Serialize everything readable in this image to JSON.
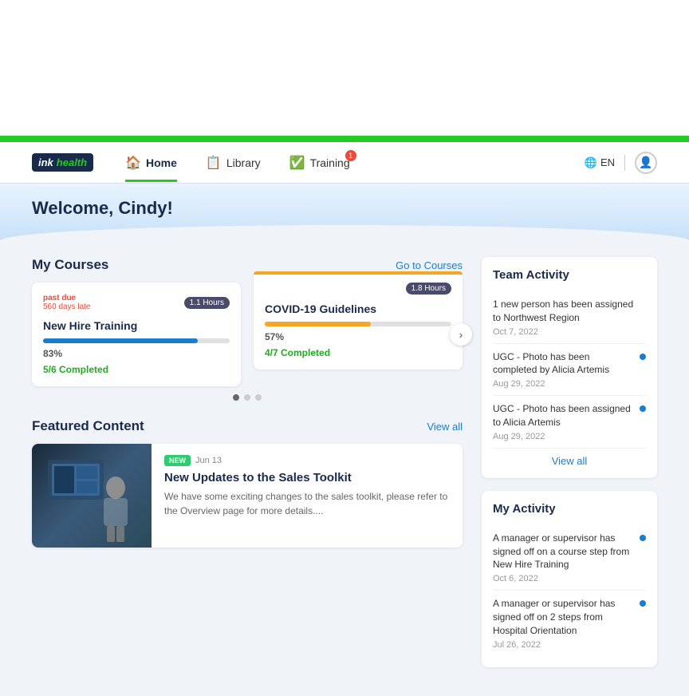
{
  "top_whitespace_height": 170,
  "green_bar": {
    "color": "#22cc22"
  },
  "navbar": {
    "logo": {
      "ink": "ink",
      "health": "health"
    },
    "nav_items": [
      {
        "label": "Home",
        "icon": "🏠",
        "active": true,
        "badge": null
      },
      {
        "label": "Library",
        "icon": "📋",
        "active": false,
        "badge": null
      },
      {
        "label": "Training",
        "icon": "✅",
        "active": false,
        "badge": "1"
      }
    ],
    "lang": "EN",
    "user_icon": "👤"
  },
  "welcome": {
    "text": "Welcome, Cindy!"
  },
  "my_courses": {
    "title": "My Courses",
    "link_label": "Go to Courses",
    "courses": [
      {
        "past_due": true,
        "past_due_label": "past due",
        "late_label": "560 days late",
        "hours": "1.1 Hours",
        "title": "New Hire Training",
        "progress_pct": 83,
        "progress_label": "83%",
        "completed": "5/6 Completed",
        "bar_color": "#1a7ccc"
      },
      {
        "past_due": false,
        "hours": "1.8 Hours",
        "title": "COVID-19 Guidelines",
        "progress_pct": 57,
        "progress_label": "57%",
        "completed": "4/7 Completed",
        "bar_color": "#f5a623",
        "has_orange_top": true
      }
    ],
    "carousel_dots": [
      true,
      false,
      false
    ]
  },
  "featured_content": {
    "title": "Featured Content",
    "link_label": "View all",
    "item": {
      "badge": "NEW",
      "date": "Jun 13",
      "title": "New Updates to the Sales Toolkit",
      "description": "We have some exciting changes to the sales toolkit, please refer to the Overview page for more details...."
    }
  },
  "team_activity": {
    "title": "Team Activity",
    "items": [
      {
        "text": "1 new person has been assigned to Northwest Region",
        "date": "Oct 7, 2022",
        "has_dot": false
      },
      {
        "text": "UGC - Photo has been completed by Alicia Artemis",
        "date": "Aug 29, 2022",
        "has_dot": true
      },
      {
        "text": "UGC - Photo has been assigned to Alicia Artemis",
        "date": "Aug 29, 2022",
        "has_dot": true
      }
    ],
    "view_all_label": "View all"
  },
  "my_activity": {
    "title": "My Activity",
    "items": [
      {
        "text": "A manager or supervisor has signed off on a course step from New Hire Training",
        "date": "Oct 6, 2022",
        "has_dot": true
      },
      {
        "text": "A manager or supervisor has signed off on 2 steps from Hospital Orientation",
        "date": "Jul 26, 2022",
        "has_dot": true
      }
    ]
  }
}
